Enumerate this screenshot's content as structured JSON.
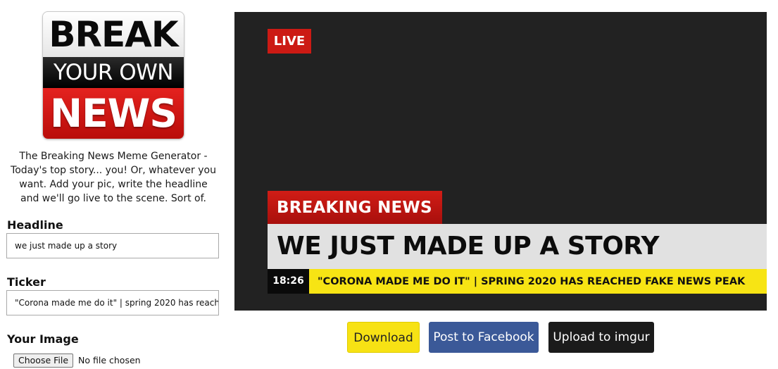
{
  "logo": {
    "line1": "BREAK",
    "line2": "YOUR OWN",
    "line3": "NEWS"
  },
  "description": "The Breaking News Meme Generator - Today's top story... you! Or, whatever you want. Add your pic, write the headline and we'll go live to the scene. Sort of.",
  "form": {
    "headline_label": "Headline",
    "headline_value": "we just made up a story",
    "ticker_label": "Ticker",
    "ticker_value": "\"Corona made me do it\" | spring 2020 has reached fake news peak",
    "image_label": "Your Image",
    "file_button": "Choose File",
    "file_status": "No file chosen"
  },
  "preview": {
    "live": "LIVE",
    "breaking": "BREAKING NEWS",
    "headline": "WE JUST MADE UP A STORY",
    "time": "18:26",
    "ticker": "\"CORONA MADE ME DO IT\" | SPRING 2020 HAS REACHED FAKE NEWS PEAK"
  },
  "actions": {
    "download": "Download",
    "facebook": "Post to Facebook",
    "imgur": "Upload to imgur"
  },
  "colors": {
    "accent_red": "#cc1a14",
    "ticker_yellow": "#f7e414",
    "facebook_blue": "#3b5998",
    "imgur_dark": "#1b1b1b"
  }
}
